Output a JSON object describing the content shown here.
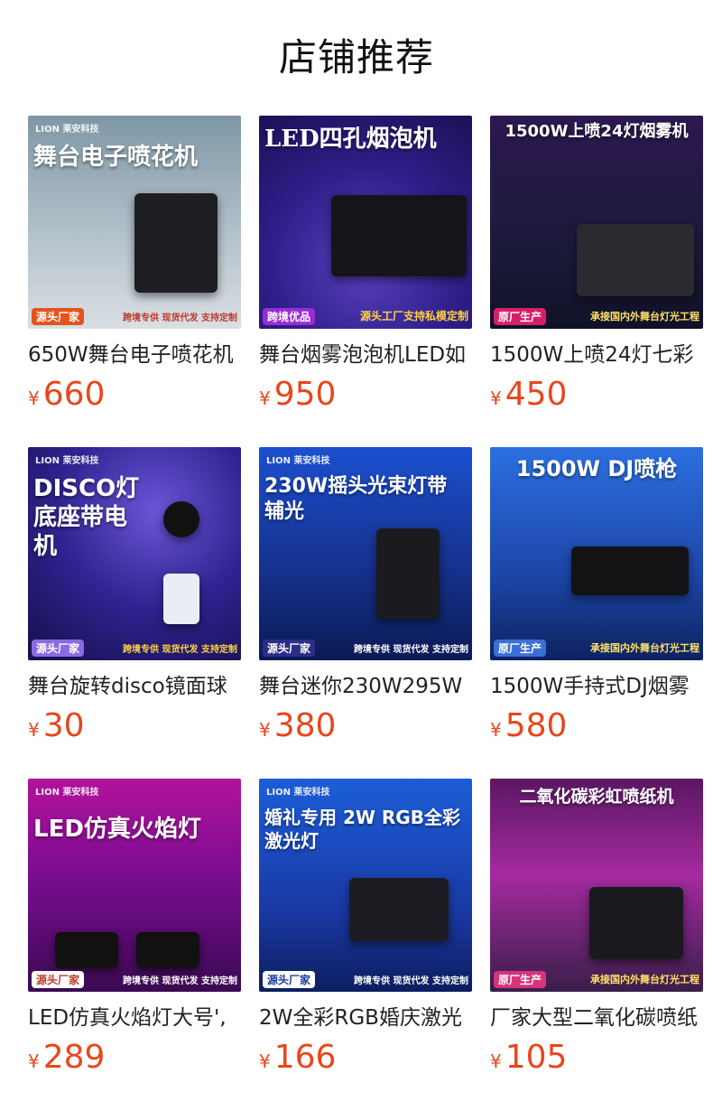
{
  "section_title": "店铺推荐",
  "products": [
    {
      "name": "650W舞台电子喷花机",
      "currency": "¥",
      "price": "660",
      "image_text": {
        "headline": "舞台电子喷花机",
        "badge": "源头厂家",
        "strip": "跨境专供 现货代发 支持定制",
        "logo": "LION 莱安科技"
      },
      "colors": {
        "bg": "#a9bac4"
      }
    },
    {
      "name": "舞台烟雾泡泡机LED如",
      "currency": "¥",
      "price": "950",
      "image_text": {
        "headline": "LED四孔烟泡机",
        "badge": "跨境优品",
        "strip": "源头工厂支持私模定制",
        "logo": ""
      },
      "colors": {
        "bg": "#2d1d86"
      }
    },
    {
      "name": "1500W上喷24灯七彩",
      "currency": "¥",
      "price": "450",
      "image_text": {
        "headline": "1500W上喷24灯烟雾机",
        "badge": "原厂生产",
        "strip": "承接国内外舞台灯光工程",
        "logo": ""
      },
      "colors": {
        "bg": "#1c1a3b"
      }
    },
    {
      "name": "舞台旋转disco镜面球",
      "currency": "¥",
      "price": "30",
      "image_text": {
        "headline": "DISCO灯底座带电机",
        "badge": "源头厂家",
        "strip": "跨境专供 现货代发 支持定制",
        "logo": "LION 莱安科技"
      },
      "colors": {
        "bg": "#2e2390"
      }
    },
    {
      "name": "舞台迷你230W295W",
      "currency": "¥",
      "price": "380",
      "image_text": {
        "headline": "230W摇头光束灯带辅光",
        "badge": "源头厂家",
        "strip": "跨境专供 现货代发 支持定制",
        "logo": "LION 莱安科技"
      },
      "colors": {
        "bg": "#15308a"
      }
    },
    {
      "name": "1500W手持式DJ烟雾",
      "currency": "¥",
      "price": "580",
      "image_text": {
        "headline": "1500W DJ喷枪",
        "badge": "原厂生产",
        "strip": "承接国内外舞台灯光工程",
        "logo": ""
      },
      "colors": {
        "bg": "#1c46a8"
      }
    },
    {
      "name": "LED仿真火焰灯大号',",
      "currency": "¥",
      "price": "289",
      "image_text": {
        "headline": "LED仿真火焰灯",
        "badge": "源头厂家",
        "strip": "跨境专供 现货代发 支持定制",
        "logo": "LION 莱安科技"
      },
      "colors": {
        "bg": "#7a0d92"
      }
    },
    {
      "name": "2W全彩RGB婚庆激光",
      "currency": "¥",
      "price": "166",
      "image_text": {
        "headline": "婚礼专用 2W RGB全彩激光灯",
        "badge": "源头厂家",
        "strip": "跨境专供 现货代发 支持定制",
        "logo": "LION 莱安科技"
      },
      "colors": {
        "bg": "#1a3aa6"
      }
    },
    {
      "name": "厂家大型二氧化碳喷纸",
      "currency": "¥",
      "price": "105",
      "image_text": {
        "headline": "二氧化碳彩虹喷纸机",
        "badge": "原厂生产",
        "strip": "承接国内外舞台灯光工程",
        "logo": ""
      },
      "colors": {
        "bg": "#a52aa0"
      }
    }
  ],
  "accent_color": "#e8461c"
}
